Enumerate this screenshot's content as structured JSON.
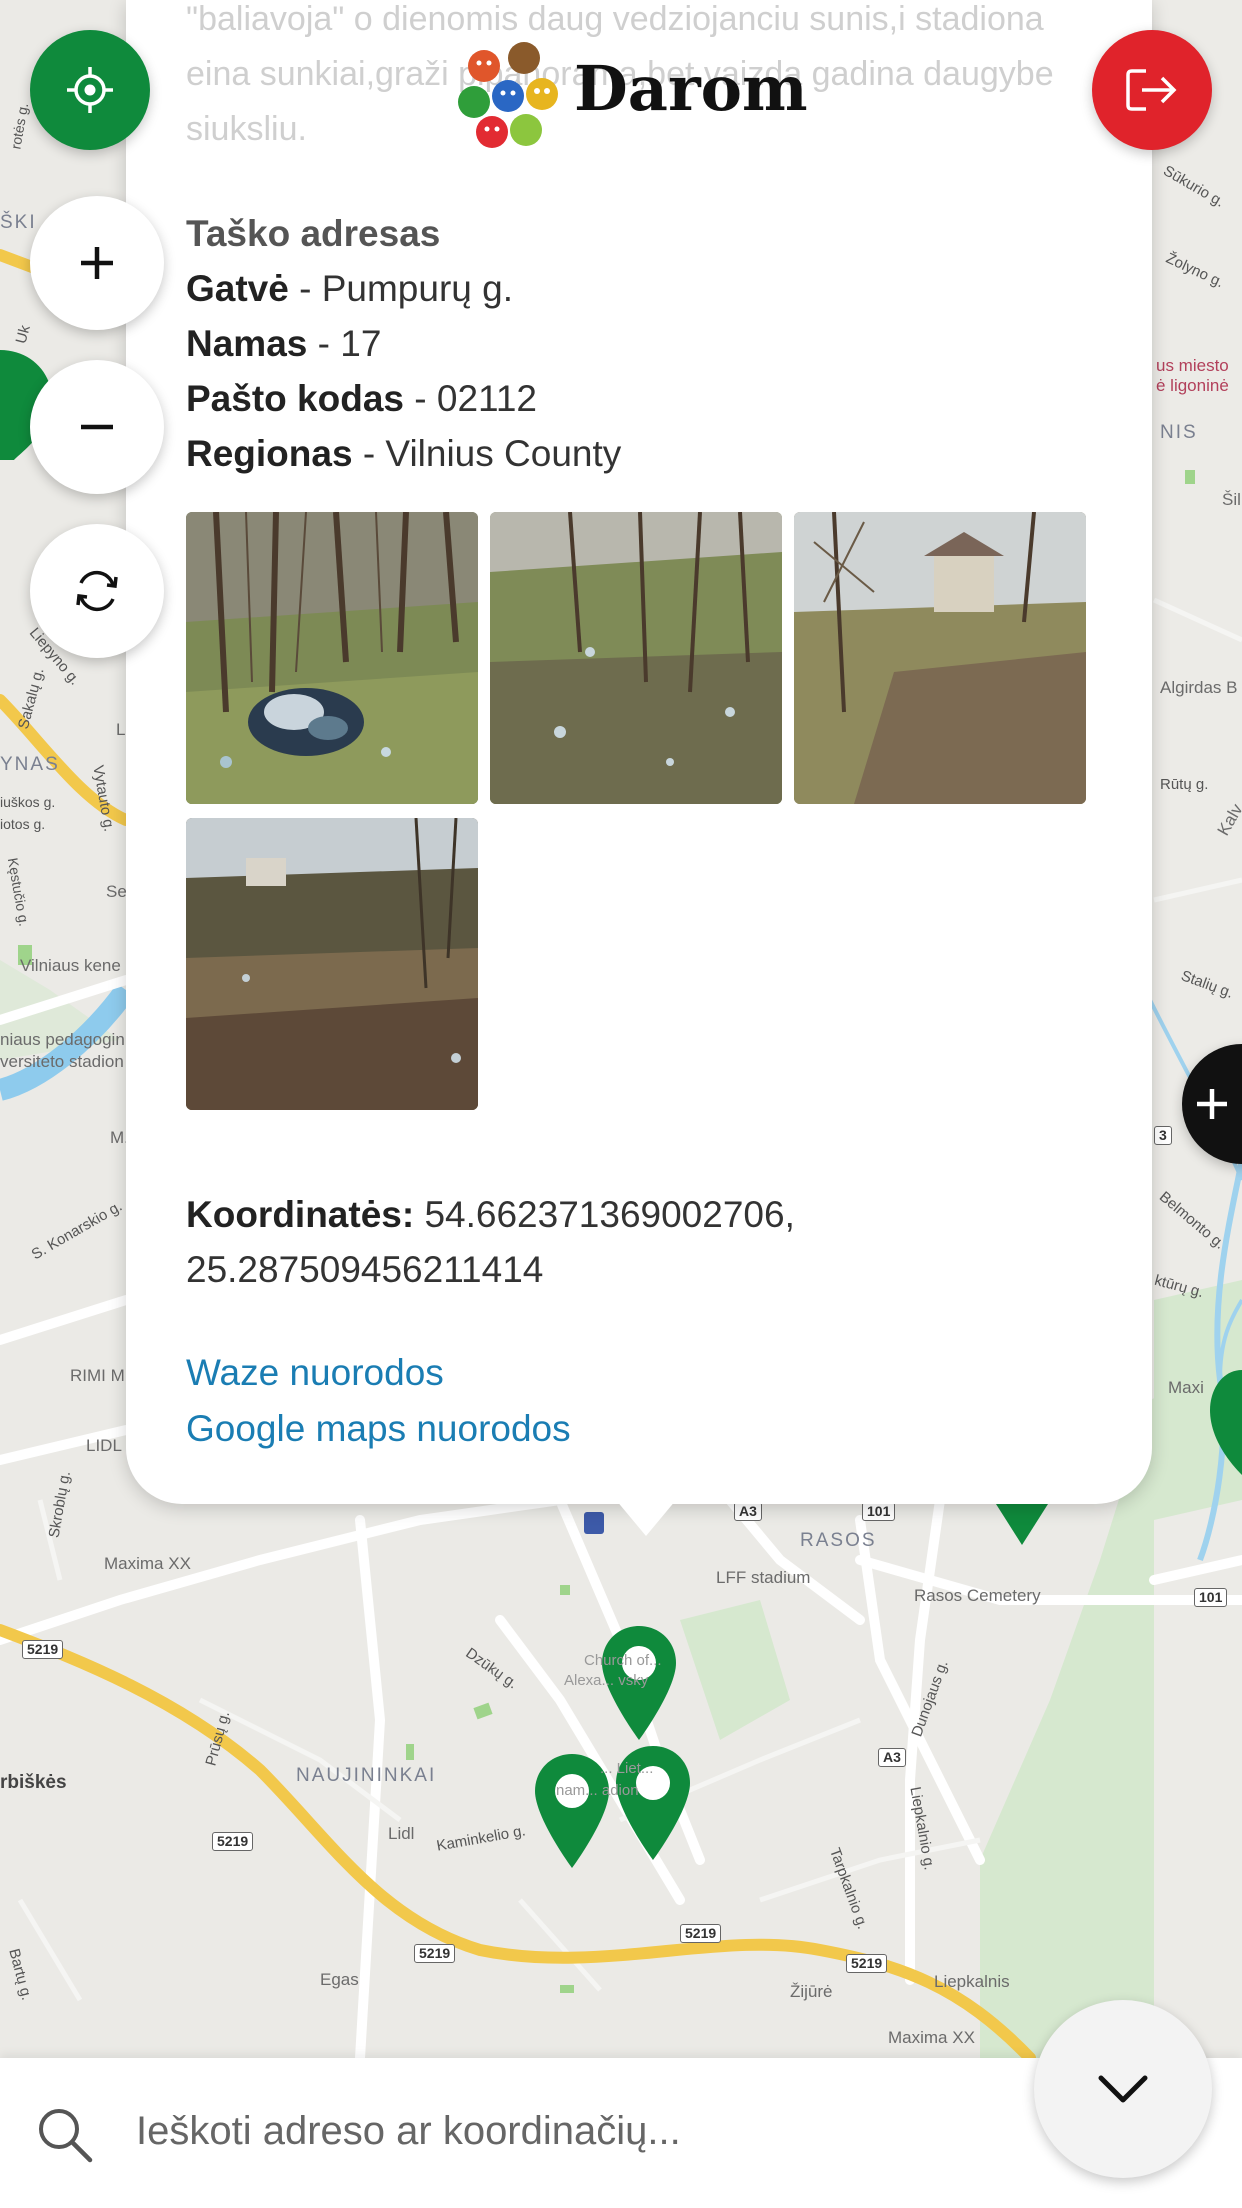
{
  "header": {
    "logo_text": "Darom"
  },
  "popup": {
    "description": "\"baliavoja\" o dienomis daug vedziojanciu sunis,i stadiona eina sunkiai,graži plpanorama,bet vaizda gadina daugybe siuksliu.",
    "address_title": "Taško adresas",
    "address": [
      {
        "label": "Gatvė",
        "value": " - Pumpurų g."
      },
      {
        "label": "Namas",
        "value": " - 17"
      },
      {
        "label": "Pašto kodas",
        "value": " - 02112"
      },
      {
        "label": "Regionas",
        "value": " - Vilnius County"
      }
    ],
    "coords_label": "Koordinatės:",
    "coords_line1": " 54.662371369002706,",
    "coords_line2": "25.287509456211414",
    "waze_link": "Waze nuorodos",
    "google_link": "Google maps nuorodos"
  },
  "search": {
    "placeholder": "Ieškoti adreso ar koordinačių..."
  },
  "map": {
    "labels": [
      {
        "text": "RASOS",
        "cls": "district"
      },
      {
        "text": "LFF stadium",
        "cls": ""
      },
      {
        "text": "Rasos Cemetery",
        "cls": ""
      },
      {
        "text": "Maxima XX",
        "cls": ""
      },
      {
        "text": "Dzūkų g.",
        "cls": "road"
      },
      {
        "text": "Prūsų g.",
        "cls": "road"
      },
      {
        "text": "NAUJININKAI",
        "cls": "district"
      },
      {
        "text": "Lidl",
        "cls": ""
      },
      {
        "text": "Kaminkelio g.",
        "cls": "road"
      },
      {
        "text": "rbiškės",
        "cls": "district"
      },
      {
        "text": "Egas",
        "cls": ""
      },
      {
        "text": "Žijūrė",
        "cls": ""
      },
      {
        "text": "Liepkalnis",
        "cls": ""
      },
      {
        "text": "Maxima XX",
        "cls": ""
      },
      {
        "text": "Dunojaus g.",
        "cls": "road"
      },
      {
        "text": "Liepkalnio g.",
        "cls": "road"
      },
      {
        "text": "Tarpkalnio g.",
        "cls": "road"
      },
      {
        "text": "Bartų g.",
        "cls": "road"
      },
      {
        "text": "Skroblų g.",
        "cls": "road"
      },
      {
        "text": "RIMI M",
        "cls": ""
      },
      {
        "text": "LIDL",
        "cls": ""
      },
      {
        "text": "S. Konarskio g.",
        "cls": "road"
      },
      {
        "text": "M.",
        "cls": ""
      },
      {
        "text": "YNAS",
        "cls": "district"
      },
      {
        "text": "Vilniaus kene",
        "cls": ""
      },
      {
        "text": "niaus pedagogin",
        "cls": ""
      },
      {
        "text": "versiteto stadion",
        "cls": ""
      },
      {
        "text": "Sūkurio g.",
        "cls": "road"
      },
      {
        "text": "Žolyno g.",
        "cls": "road"
      },
      {
        "text": "us miesto",
        "cls": ""
      },
      {
        "text": "ė ligoninė",
        "cls": ""
      },
      {
        "text": "NIS",
        "cls": "district"
      },
      {
        "text": "Algirdas B",
        "cls": ""
      },
      {
        "text": "Rūtų g.",
        "cls": "road"
      },
      {
        "text": "Stalių g.",
        "cls": "road"
      },
      {
        "text": "Belmonto g.",
        "cls": "road"
      },
      {
        "text": "ktūrų g.",
        "cls": "road"
      },
      {
        "text": "Maxi",
        "cls": ""
      },
      {
        "text": "Church of...",
        "cls": ""
      },
      {
        "text": "Alexa... vsky",
        "cls": ""
      },
      {
        "text": "... Liet...",
        "cls": ""
      },
      {
        "text": "nam... adion",
        "cls": ""
      },
      {
        "text": "ŠKI",
        "cls": "district"
      },
      {
        "text": "Liepyno g.",
        "cls": "road"
      },
      {
        "text": "Sakalų g.",
        "cls": "road"
      },
      {
        "text": "Vytauto g.",
        "cls": "road"
      },
      {
        "text": "iuškos g.",
        "cls": "road"
      },
      {
        "text": "iotos g.",
        "cls": "road"
      },
      {
        "text": "Kęstučio g.",
        "cls": "road"
      },
      {
        "text": "Uk",
        "cls": "road"
      },
      {
        "text": "Se",
        "cls": ""
      },
      {
        "text": "L",
        "cls": ""
      },
      {
        "text": "Šil",
        "cls": ""
      },
      {
        "text": "Kalv",
        "cls": ""
      },
      {
        "text": "rotės g.",
        "cls": "road"
      }
    ],
    "shields": [
      "5219",
      "5219",
      "5219",
      "5219",
      "5219",
      "A3",
      "A3",
      "101",
      "101",
      "3"
    ]
  },
  "colors": {
    "accent_green": "#0f8a3c",
    "exit_red": "#e0232b",
    "link_blue": "#1a7db3"
  },
  "icons": {
    "locate": "crosshair-icon",
    "zoom_in": "plus-icon",
    "zoom_out": "minus-icon",
    "refresh": "refresh-icon",
    "exit": "logout-icon",
    "add": "plus-icon",
    "collapse": "chevron-down-icon",
    "search": "search-icon"
  }
}
